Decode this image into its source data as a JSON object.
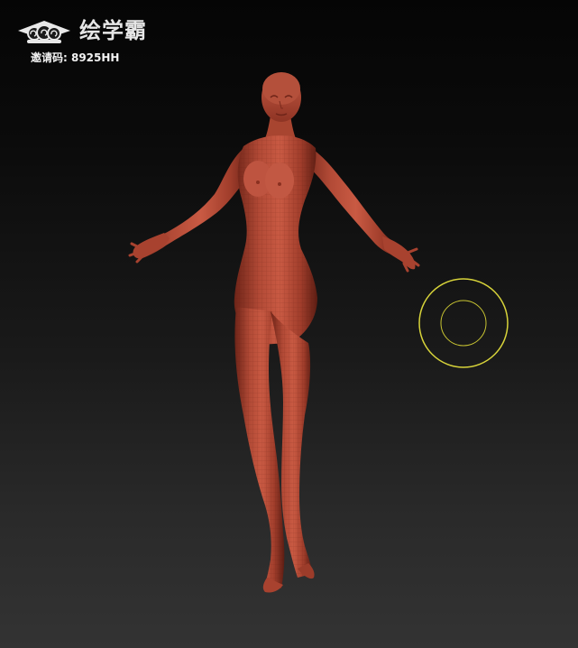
{
  "viewport": {
    "background_top": "#050505",
    "background_bottom": "#333333"
  },
  "watermark": {
    "logo_icon": "graduation-cap-cloud-icon",
    "brand_name": "绘学霸",
    "invite_code": "邀请码: 8925HH"
  },
  "model": {
    "kind": "female-base-mesh",
    "material_color": "#b24a36"
  },
  "brush_cursor": {
    "color": "#d8d43a",
    "icon": "brush-circle-icon"
  }
}
